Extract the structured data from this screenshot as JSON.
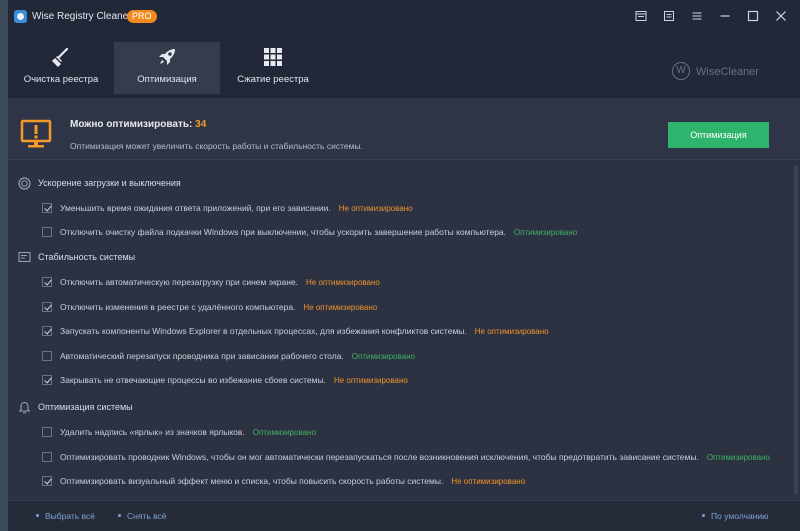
{
  "app": {
    "title": "Wise Registry Cleaner 11",
    "badge": "PRO",
    "brand_text": "WiseCleaner",
    "brand_letter": "W"
  },
  "tabs": [
    {
      "label": "Очистка реестра",
      "icon": "broom-icon",
      "active": false
    },
    {
      "label": "Оптимизация",
      "icon": "rocket-icon",
      "active": true
    },
    {
      "label": "Сжатие реестра",
      "icon": "blocks-icon",
      "active": false
    }
  ],
  "summary": {
    "title": "Можно оптимизировать:",
    "count": "34",
    "description": "Оптимизация может увеличить скорость работы и стабильность системы.",
    "button": "Оптимизация"
  },
  "sections": [
    {
      "label": "Ускорение загрузки и выключения",
      "icon": "power-icon",
      "items": [
        {
          "text": "Уменьшить время ожидания ответа приложений, при его зависании.",
          "status": "Не оптимизировано",
          "checked": true,
          "optimized": false
        },
        {
          "text": "Отключить очистку файла подкачки Windows при выключении, чтобы ускорить завершение работы компьютера.",
          "status": "Оптимизировано",
          "checked": false,
          "optimized": true
        }
      ]
    },
    {
      "label": "Стабильность системы",
      "icon": "system-list-icon",
      "items": [
        {
          "text": "Отключить автоматическую перезагрузку при синем экране.",
          "status": "Не оптимизировано",
          "checked": true,
          "optimized": false
        },
        {
          "text": "Отключить изменения в реестре с удалённого компьютера.",
          "status": "Не оптимизировано",
          "checked": true,
          "optimized": false
        },
        {
          "text": "Запускать компоненты Windows Explorer в отдельных процессах, для избежания конфликтов системы.",
          "status": "Не оптимизировано",
          "checked": true,
          "optimized": false
        },
        {
          "text": "Автоматический перезапуск проводника при зависании рабочего стола.",
          "status": "Оптимизировано",
          "checked": false,
          "optimized": true
        },
        {
          "text": "Закрывать не отвечающие процессы во избежание сбоев системы.",
          "status": "Не оптимизировано",
          "checked": true,
          "optimized": false
        }
      ]
    },
    {
      "label": "Оптимизация системы",
      "icon": "bell-icon",
      "items": [
        {
          "text": "Удалить надпись «ярлык» из значков ярлыков.",
          "status": "Оптимизировано",
          "checked": false,
          "optimized": true
        },
        {
          "text": "Оптимизировать проводник Windows, чтобы он мог автоматически перезапускаться после возникновения исключения, чтобы предотвратить зависание системы.",
          "status": "Оптимизировано",
          "checked": false,
          "optimized": true
        },
        {
          "text": "Оптимизировать визуальный эффект меню и списка, чтобы повысить скорость работы системы.",
          "status": "Не оптимизировано",
          "checked": true,
          "optimized": false
        }
      ]
    }
  ],
  "footer": {
    "select_all": "Выбрать всё",
    "deselect_all": "Снять всё",
    "default": "По умолчанию"
  },
  "colors": {
    "accent_green": "#2fb46e",
    "warning_orange": "#f39a2a",
    "badge_orange": "#f08c1e"
  }
}
